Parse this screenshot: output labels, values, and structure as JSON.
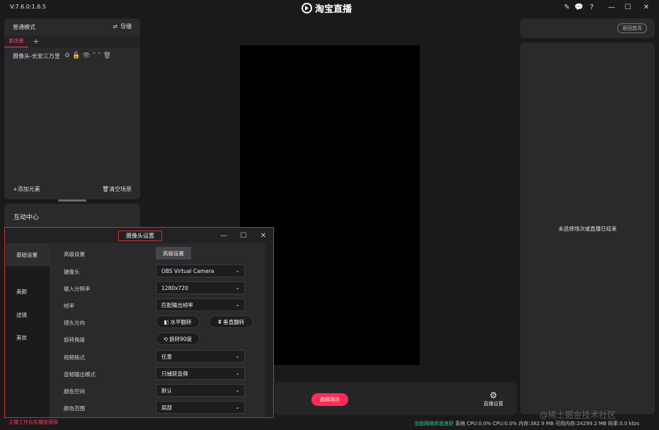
{
  "window": {
    "version": "V:7.6.0:1.6.5",
    "title": "淘宝直播",
    "controls": [
      "edit-icon",
      "chat-icon",
      "help-icon",
      "minimize-icon",
      "maximize-icon",
      "close-icon"
    ]
  },
  "scene_panel": {
    "mode_label": "普通模式",
    "guide_label": "导播",
    "tabs": [
      {
        "label": "新场景"
      }
    ],
    "add_tab": "+",
    "sources": [
      {
        "name": "摄像头-长安三万里"
      }
    ],
    "add_element": "添加元素",
    "clear_scene": "清空场景"
  },
  "interaction_panel": {
    "title": "互动中心"
  },
  "bottom_bar": {
    "select_scene": "选择场次",
    "live_settings": "直播设置"
  },
  "right_panel": {
    "home_button": "返回首页",
    "message": "未选择场次或直播已结束"
  },
  "status_bar": {
    "left": "主播工作台实播连接局",
    "network": "当前网络状态良好",
    "system": "系统 CPU:0.0% CPU:0.0% 内存:382.9 MB 可用内存:24299.2 MB 码率:0.0 kb/s"
  },
  "watermark": "@稀土掘金技术社区",
  "dialog": {
    "title": "摄像头设置",
    "nav": [
      "基础设置",
      "美颜",
      "滤镜",
      "美妆"
    ],
    "active_nav": 0,
    "rows": {
      "advanced": {
        "label": "高级设置",
        "button": "高级设置"
      },
      "camera": {
        "label": "摄像头",
        "value": "OBS Virtual Camera"
      },
      "resolution": {
        "label": "输入分辨率",
        "value": "1280x720"
      },
      "framerate": {
        "label": "帧率",
        "value": "匹配输出帧率"
      },
      "direction": {
        "label": "镜头方向",
        "horizontal": "水平翻转",
        "vertical": "垂直翻转"
      },
      "rotation": {
        "label": "旋转角度",
        "rotate": "旋转90度"
      },
      "video_format": {
        "label": "视频格式",
        "value": "任意"
      },
      "audio_mode": {
        "label": "音频输出模式",
        "value": "只捕获音频"
      },
      "color_space": {
        "label": "颜色空间",
        "value": "默认"
      },
      "color_range": {
        "label": "颜色范围",
        "value": "局部"
      }
    }
  }
}
